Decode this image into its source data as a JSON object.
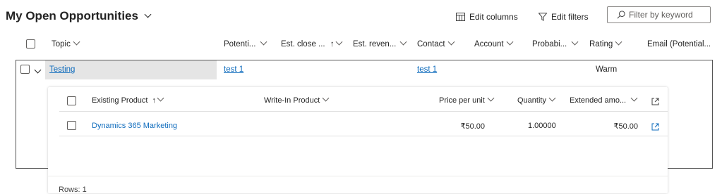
{
  "view": {
    "title": "My Open Opportunities"
  },
  "toolbar": {
    "edit_columns": "Edit columns",
    "edit_filters": "Edit filters",
    "filter_placeholder": "Filter by keyword"
  },
  "grid": {
    "columns": {
      "topic": "Topic",
      "potential": "Potenti...",
      "est_close": "Est. close ...",
      "est_revenue": "Est. reven...",
      "contact": "Contact",
      "account": "Account",
      "probability": "Probabi...",
      "rating": "Rating",
      "email": "Email (Potential..."
    },
    "rows": [
      {
        "topic": "Testing",
        "potential": "test 1",
        "contact": "test 1",
        "rating": "Warm"
      }
    ]
  },
  "subgrid": {
    "columns": {
      "existing_product": "Existing Product",
      "write_in_product": "Write-In Product",
      "price_per_unit": "Price per unit",
      "quantity": "Quantity",
      "extended_amount": "Extended amo..."
    },
    "rows": [
      {
        "product": "Dynamics 365 Marketing",
        "price": "₹50.00",
        "quantity": "1.00000",
        "extended": "₹50.00"
      }
    ],
    "footer": "Rows: 1"
  }
}
